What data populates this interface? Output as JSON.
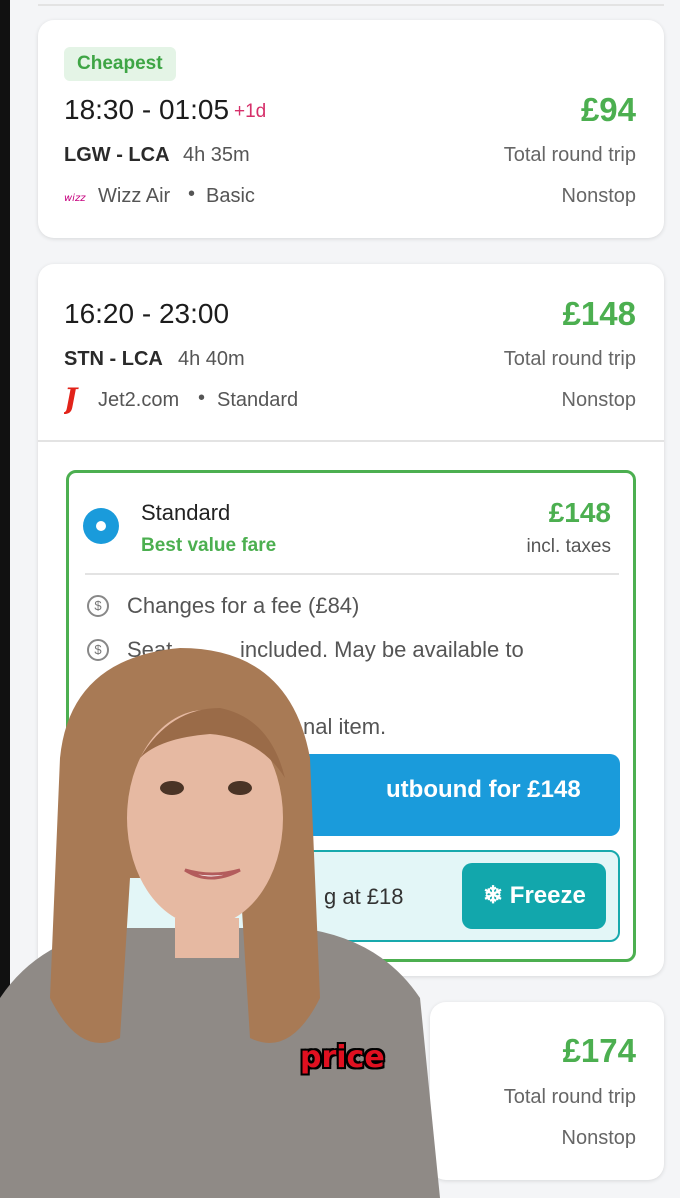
{
  "flights": [
    {
      "badge": "Cheapest",
      "time": "18:30 - 01:05",
      "next_day": "+1d",
      "route": "LGW - LCA",
      "duration": "4h 35m",
      "airline": "Wizz Air",
      "fare_class": "Basic",
      "price": "£94",
      "price_note": "Total round trip",
      "stops": "Nonstop"
    },
    {
      "time": "16:20 - 23:00",
      "route": "STN - LCA",
      "duration": "4h 40m",
      "airline": "Jet2.com",
      "fare_class": "Standard",
      "price": "£148",
      "price_note": "Total round trip",
      "stops": "Nonstop",
      "fare": {
        "name": "Standard",
        "tag": "Best value fare",
        "price": "£148",
        "price_note": "incl. taxes",
        "features": [
          "Changes for a fee (£84)",
          "Seat",
          "included. May be available to",
          "nal item."
        ],
        "book_label": "utbound for £148",
        "freeze_text": "g at £18",
        "freeze_label": "❄ Freeze"
      }
    },
    {
      "price": "£174",
      "price_note": "Total round trip",
      "stops": "Nonstop"
    }
  ],
  "caption": "price",
  "colors": {
    "price_green": "#4caf50",
    "book_blue": "#1a9bdb",
    "freeze_teal": "#12a7ac",
    "next_day_pink": "#d6306a"
  }
}
